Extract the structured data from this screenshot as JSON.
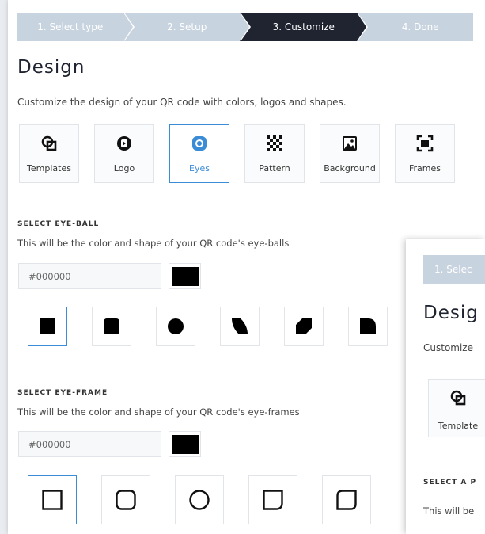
{
  "steps": [
    {
      "label": "1. Select type",
      "active": false
    },
    {
      "label": "2. Setup",
      "active": false
    },
    {
      "label": "3. Customize",
      "active": true
    },
    {
      "label": "4. Done",
      "active": false
    }
  ],
  "page": {
    "title": "Design",
    "description": "Customize the design of your QR code with colors, logos and shapes."
  },
  "tabs": [
    {
      "label": "Templates",
      "icon": "templates-icon"
    },
    {
      "label": "Logo",
      "icon": "logo-icon"
    },
    {
      "label": "Eyes",
      "icon": "eyes-icon",
      "active": true
    },
    {
      "label": "Pattern",
      "icon": "pattern-icon"
    },
    {
      "label": "Background",
      "icon": "background-icon"
    },
    {
      "label": "Frames",
      "icon": "frames-icon"
    }
  ],
  "eye_ball": {
    "title": "SELECT EYE-BALL",
    "description": "This will be the color and shape of your QR code's eye-balls",
    "color_value": "#000000",
    "swatch_color": "#000000",
    "shapes": [
      "square",
      "rounded-square",
      "circle",
      "leaf-top-left",
      "leaf-diagonal",
      "leaf-top-right"
    ]
  },
  "eye_frame": {
    "title": "SELECT EYE-FRAME",
    "description": "This will be the color and shape of your QR code's eye-frames",
    "color_value": "#000000",
    "swatch_color": "#000000",
    "shapes": [
      "square",
      "rounded",
      "circle",
      "rounded-corner",
      "rounded-corners-alt"
    ]
  },
  "overlay": {
    "step_label": "1. Selec",
    "title": "Desig",
    "description": "Customize",
    "tab_label": "Template",
    "section_title": "SELECT A P",
    "section_desc": "This will be"
  },
  "colors": {
    "accent": "#3b8cd6",
    "step_active": "#1f2430",
    "step_inactive": "#c8d3e0"
  }
}
